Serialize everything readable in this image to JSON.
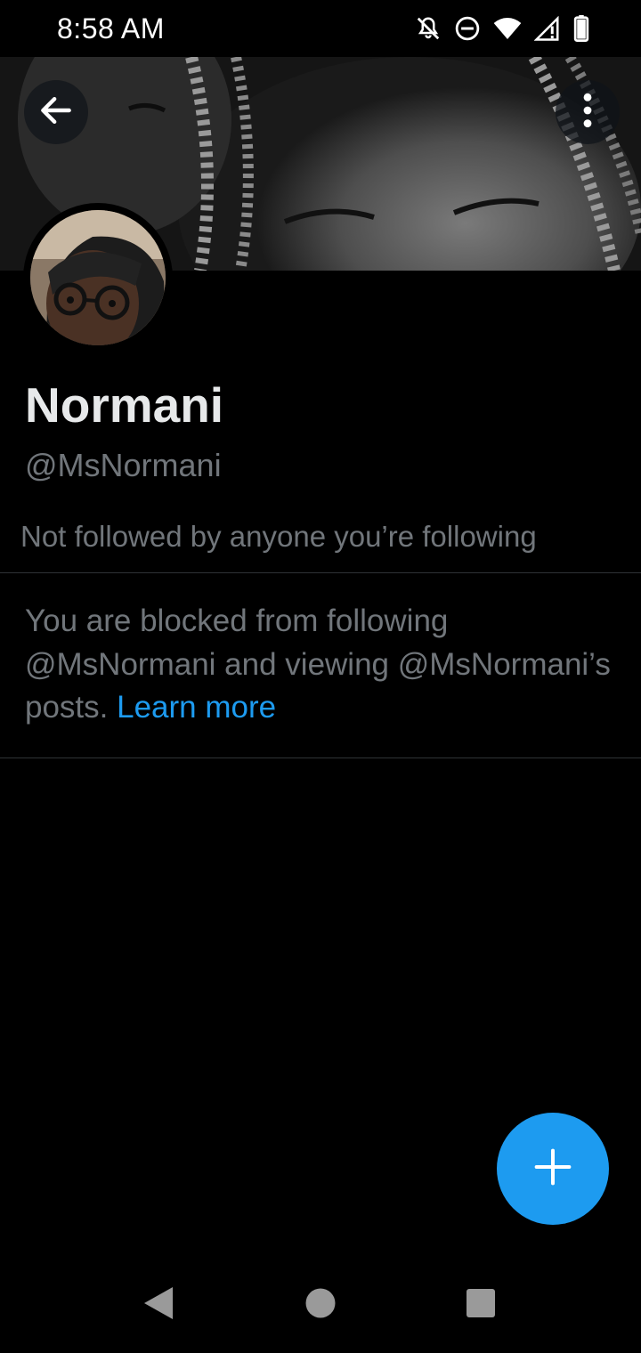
{
  "status_bar": {
    "time": "8:58 AM",
    "icons": [
      "notifications-off-icon",
      "do-not-disturb-icon",
      "wifi-icon",
      "cellular-signal-icon",
      "battery-icon"
    ]
  },
  "header": {
    "back_icon": "arrow-left-icon",
    "more_icon": "more-vertical-icon"
  },
  "profile": {
    "display_name": "Normani",
    "handle": "@MsNormani",
    "followed_note": "Not followed by anyone you’re following"
  },
  "blocked": {
    "message": "You are blocked from following @MsNormani and viewing @MsNormani’s posts.",
    "link_text": "Learn more"
  },
  "fab": {
    "icon": "plus-icon"
  },
  "nav": {
    "icons": [
      "nav-back-icon",
      "nav-home-icon",
      "nav-recents-icon"
    ]
  },
  "colors": {
    "background": "#000000",
    "accent": "#1d9bf0",
    "primary_text": "#e7e9ea",
    "secondary_text": "#71767b",
    "divider": "#2f3336"
  }
}
